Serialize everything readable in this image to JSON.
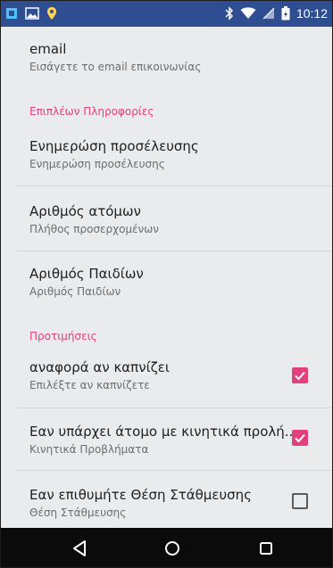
{
  "status_bar": {
    "time": "10:12",
    "left_icons": [
      "square-app-icon",
      "photo-icon",
      "location-pin-icon"
    ],
    "right_icons": [
      "bluetooth-icon",
      "wifi-icon",
      "signal-icon",
      "battery-icon"
    ],
    "background": "#2f4d91"
  },
  "preferences": {
    "email": {
      "title": "email",
      "summary": "Εισάγετε το email επικοινωνίας"
    },
    "category_extra": "Επιπλέων Πληροφορίες",
    "arrival": {
      "title": "Ενημερώση προσέλευσης",
      "summary": "Ενημερώση προσέλευσης"
    },
    "people": {
      "title": "Αριθμός ατόμων",
      "summary": "Πλήθος προσερχομένων"
    },
    "children": {
      "title": "Αριθμός Παιδίων",
      "summary": "Αριθμός Παιδίων"
    },
    "category_prefs": "Προτιμήσεις",
    "smoking": {
      "title": "αναφορά αν καπνίζει",
      "summary": "Επιλέξτε αν καπνίζετε",
      "checked": true
    },
    "mobility": {
      "title": "Εαν υπάρχει άτομο με κινητικά προλή..",
      "summary": "Κινητικά Προβλήματα",
      "checked": true
    },
    "parking": {
      "title": "Εαν επιθυμήτε Θέση Στάθμευσης",
      "summary": "Θέση Στάθμευσης",
      "checked": false
    }
  },
  "navigation": {
    "back": "back-triangle-icon",
    "home": "home-circle-icon",
    "recents": "recents-square-icon"
  },
  "colors": {
    "accent": "#e0407e",
    "background": "#e9ebec",
    "navbar": "#0b0b0b"
  }
}
